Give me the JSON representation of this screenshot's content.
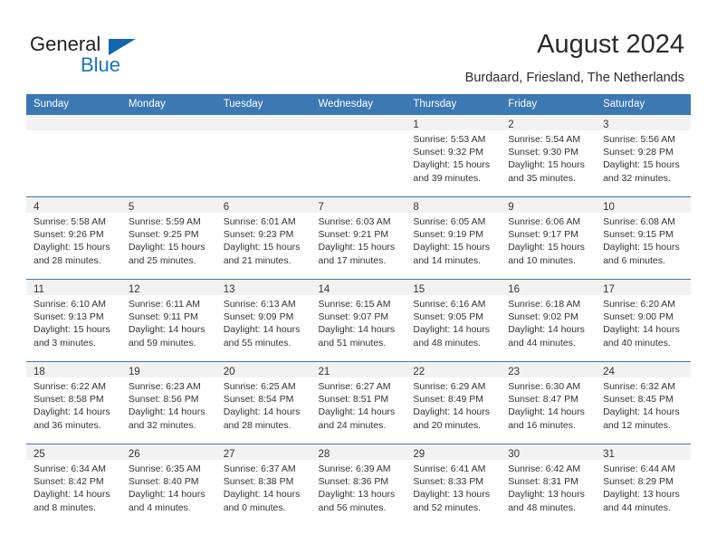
{
  "brand": {
    "name_top": "General",
    "name_bottom": "Blue",
    "accent_color": "#1b75bb",
    "triangle_color": "#1267b2"
  },
  "header": {
    "title": "August 2024",
    "subtitle": "Burdaard, Friesland, The Netherlands"
  },
  "theme": {
    "header_row_bg": "#3c78b4",
    "daynum_band_bg": "#f2f2f2",
    "text_color": "#333333"
  },
  "weekdays": [
    "Sunday",
    "Monday",
    "Tuesday",
    "Wednesday",
    "Thursday",
    "Friday",
    "Saturday"
  ],
  "weeks": [
    [
      {
        "day": "",
        "sunrise": "",
        "sunset": "",
        "daylight_line1": "",
        "daylight_line2": ""
      },
      {
        "day": "",
        "sunrise": "",
        "sunset": "",
        "daylight_line1": "",
        "daylight_line2": ""
      },
      {
        "day": "",
        "sunrise": "",
        "sunset": "",
        "daylight_line1": "",
        "daylight_line2": ""
      },
      {
        "day": "",
        "sunrise": "",
        "sunset": "",
        "daylight_line1": "",
        "daylight_line2": ""
      },
      {
        "day": "1",
        "sunrise": "Sunrise: 5:53 AM",
        "sunset": "Sunset: 9:32 PM",
        "daylight_line1": "Daylight: 15 hours",
        "daylight_line2": "and 39 minutes."
      },
      {
        "day": "2",
        "sunrise": "Sunrise: 5:54 AM",
        "sunset": "Sunset: 9:30 PM",
        "daylight_line1": "Daylight: 15 hours",
        "daylight_line2": "and 35 minutes."
      },
      {
        "day": "3",
        "sunrise": "Sunrise: 5:56 AM",
        "sunset": "Sunset: 9:28 PM",
        "daylight_line1": "Daylight: 15 hours",
        "daylight_line2": "and 32 minutes."
      }
    ],
    [
      {
        "day": "4",
        "sunrise": "Sunrise: 5:58 AM",
        "sunset": "Sunset: 9:26 PM",
        "daylight_line1": "Daylight: 15 hours",
        "daylight_line2": "and 28 minutes."
      },
      {
        "day": "5",
        "sunrise": "Sunrise: 5:59 AM",
        "sunset": "Sunset: 9:25 PM",
        "daylight_line1": "Daylight: 15 hours",
        "daylight_line2": "and 25 minutes."
      },
      {
        "day": "6",
        "sunrise": "Sunrise: 6:01 AM",
        "sunset": "Sunset: 9:23 PM",
        "daylight_line1": "Daylight: 15 hours",
        "daylight_line2": "and 21 minutes."
      },
      {
        "day": "7",
        "sunrise": "Sunrise: 6:03 AM",
        "sunset": "Sunset: 9:21 PM",
        "daylight_line1": "Daylight: 15 hours",
        "daylight_line2": "and 17 minutes."
      },
      {
        "day": "8",
        "sunrise": "Sunrise: 6:05 AM",
        "sunset": "Sunset: 9:19 PM",
        "daylight_line1": "Daylight: 15 hours",
        "daylight_line2": "and 14 minutes."
      },
      {
        "day": "9",
        "sunrise": "Sunrise: 6:06 AM",
        "sunset": "Sunset: 9:17 PM",
        "daylight_line1": "Daylight: 15 hours",
        "daylight_line2": "and 10 minutes."
      },
      {
        "day": "10",
        "sunrise": "Sunrise: 6:08 AM",
        "sunset": "Sunset: 9:15 PM",
        "daylight_line1": "Daylight: 15 hours",
        "daylight_line2": "and 6 minutes."
      }
    ],
    [
      {
        "day": "11",
        "sunrise": "Sunrise: 6:10 AM",
        "sunset": "Sunset: 9:13 PM",
        "daylight_line1": "Daylight: 15 hours",
        "daylight_line2": "and 3 minutes."
      },
      {
        "day": "12",
        "sunrise": "Sunrise: 6:11 AM",
        "sunset": "Sunset: 9:11 PM",
        "daylight_line1": "Daylight: 14 hours",
        "daylight_line2": "and 59 minutes."
      },
      {
        "day": "13",
        "sunrise": "Sunrise: 6:13 AM",
        "sunset": "Sunset: 9:09 PM",
        "daylight_line1": "Daylight: 14 hours",
        "daylight_line2": "and 55 minutes."
      },
      {
        "day": "14",
        "sunrise": "Sunrise: 6:15 AM",
        "sunset": "Sunset: 9:07 PM",
        "daylight_line1": "Daylight: 14 hours",
        "daylight_line2": "and 51 minutes."
      },
      {
        "day": "15",
        "sunrise": "Sunrise: 6:16 AM",
        "sunset": "Sunset: 9:05 PM",
        "daylight_line1": "Daylight: 14 hours",
        "daylight_line2": "and 48 minutes."
      },
      {
        "day": "16",
        "sunrise": "Sunrise: 6:18 AM",
        "sunset": "Sunset: 9:02 PM",
        "daylight_line1": "Daylight: 14 hours",
        "daylight_line2": "and 44 minutes."
      },
      {
        "day": "17",
        "sunrise": "Sunrise: 6:20 AM",
        "sunset": "Sunset: 9:00 PM",
        "daylight_line1": "Daylight: 14 hours",
        "daylight_line2": "and 40 minutes."
      }
    ],
    [
      {
        "day": "18",
        "sunrise": "Sunrise: 6:22 AM",
        "sunset": "Sunset: 8:58 PM",
        "daylight_line1": "Daylight: 14 hours",
        "daylight_line2": "and 36 minutes."
      },
      {
        "day": "19",
        "sunrise": "Sunrise: 6:23 AM",
        "sunset": "Sunset: 8:56 PM",
        "daylight_line1": "Daylight: 14 hours",
        "daylight_line2": "and 32 minutes."
      },
      {
        "day": "20",
        "sunrise": "Sunrise: 6:25 AM",
        "sunset": "Sunset: 8:54 PM",
        "daylight_line1": "Daylight: 14 hours",
        "daylight_line2": "and 28 minutes."
      },
      {
        "day": "21",
        "sunrise": "Sunrise: 6:27 AM",
        "sunset": "Sunset: 8:51 PM",
        "daylight_line1": "Daylight: 14 hours",
        "daylight_line2": "and 24 minutes."
      },
      {
        "day": "22",
        "sunrise": "Sunrise: 6:29 AM",
        "sunset": "Sunset: 8:49 PM",
        "daylight_line1": "Daylight: 14 hours",
        "daylight_line2": "and 20 minutes."
      },
      {
        "day": "23",
        "sunrise": "Sunrise: 6:30 AM",
        "sunset": "Sunset: 8:47 PM",
        "daylight_line1": "Daylight: 14 hours",
        "daylight_line2": "and 16 minutes."
      },
      {
        "day": "24",
        "sunrise": "Sunrise: 6:32 AM",
        "sunset": "Sunset: 8:45 PM",
        "daylight_line1": "Daylight: 14 hours",
        "daylight_line2": "and 12 minutes."
      }
    ],
    [
      {
        "day": "25",
        "sunrise": "Sunrise: 6:34 AM",
        "sunset": "Sunset: 8:42 PM",
        "daylight_line1": "Daylight: 14 hours",
        "daylight_line2": "and 8 minutes."
      },
      {
        "day": "26",
        "sunrise": "Sunrise: 6:35 AM",
        "sunset": "Sunset: 8:40 PM",
        "daylight_line1": "Daylight: 14 hours",
        "daylight_line2": "and 4 minutes."
      },
      {
        "day": "27",
        "sunrise": "Sunrise: 6:37 AM",
        "sunset": "Sunset: 8:38 PM",
        "daylight_line1": "Daylight: 14 hours",
        "daylight_line2": "and 0 minutes."
      },
      {
        "day": "28",
        "sunrise": "Sunrise: 6:39 AM",
        "sunset": "Sunset: 8:36 PM",
        "daylight_line1": "Daylight: 13 hours",
        "daylight_line2": "and 56 minutes."
      },
      {
        "day": "29",
        "sunrise": "Sunrise: 6:41 AM",
        "sunset": "Sunset: 8:33 PM",
        "daylight_line1": "Daylight: 13 hours",
        "daylight_line2": "and 52 minutes."
      },
      {
        "day": "30",
        "sunrise": "Sunrise: 6:42 AM",
        "sunset": "Sunset: 8:31 PM",
        "daylight_line1": "Daylight: 13 hours",
        "daylight_line2": "and 48 minutes."
      },
      {
        "day": "31",
        "sunrise": "Sunrise: 6:44 AM",
        "sunset": "Sunset: 8:29 PM",
        "daylight_line1": "Daylight: 13 hours",
        "daylight_line2": "and 44 minutes."
      }
    ]
  ]
}
